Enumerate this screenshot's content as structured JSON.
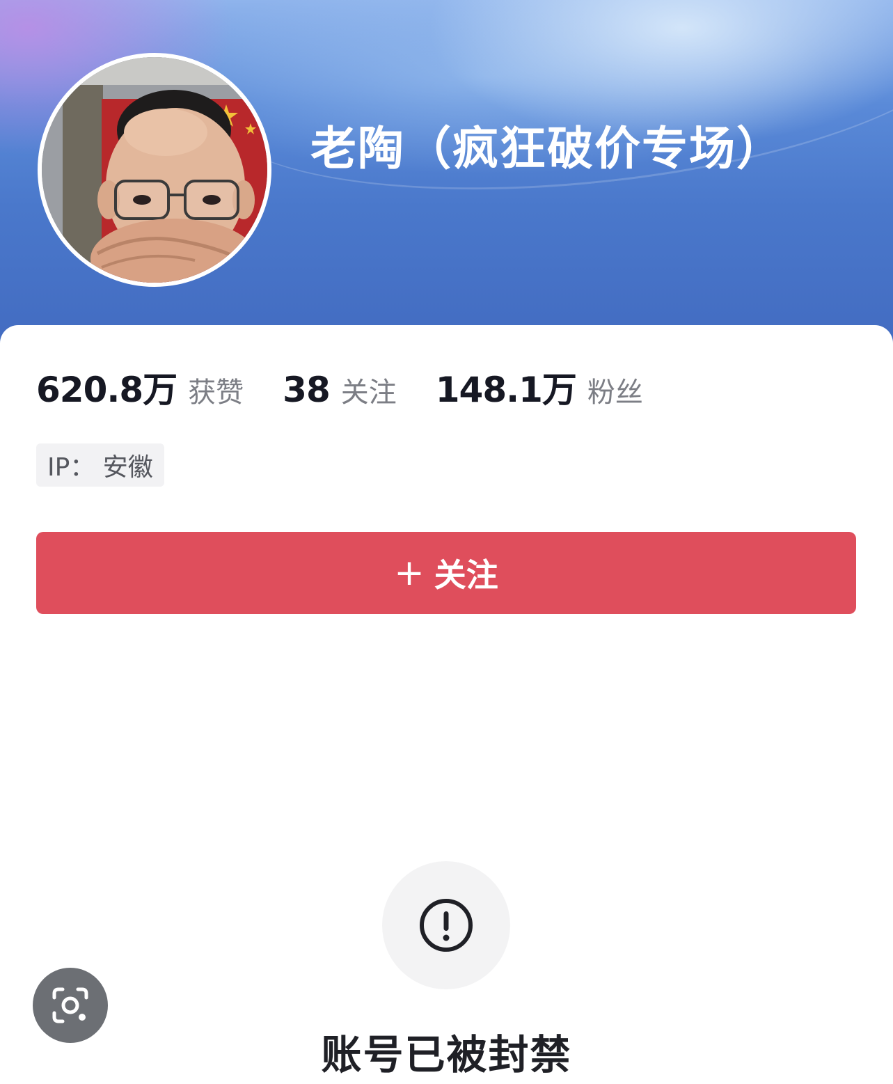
{
  "profile": {
    "display_name": "老陶（疯狂破价专场）",
    "stats": [
      {
        "value": "620.8万",
        "label": "获赞"
      },
      {
        "value": "38",
        "label": "关注"
      },
      {
        "value": "148.1万",
        "label": "粉丝"
      }
    ],
    "ip_location": "IP： 安徽",
    "follow_button": {
      "plus": "+",
      "label": "关注"
    }
  },
  "status": {
    "icon": "exclamation-circle-icon",
    "message": "账号已被封禁"
  },
  "overlay": {
    "icon": "lens-camera-icon"
  },
  "colors": {
    "header_blue": "#4a78cb",
    "follow_red": "#df4e5c",
    "stat_text": "#161823",
    "muted_text": "#7c7e85"
  }
}
